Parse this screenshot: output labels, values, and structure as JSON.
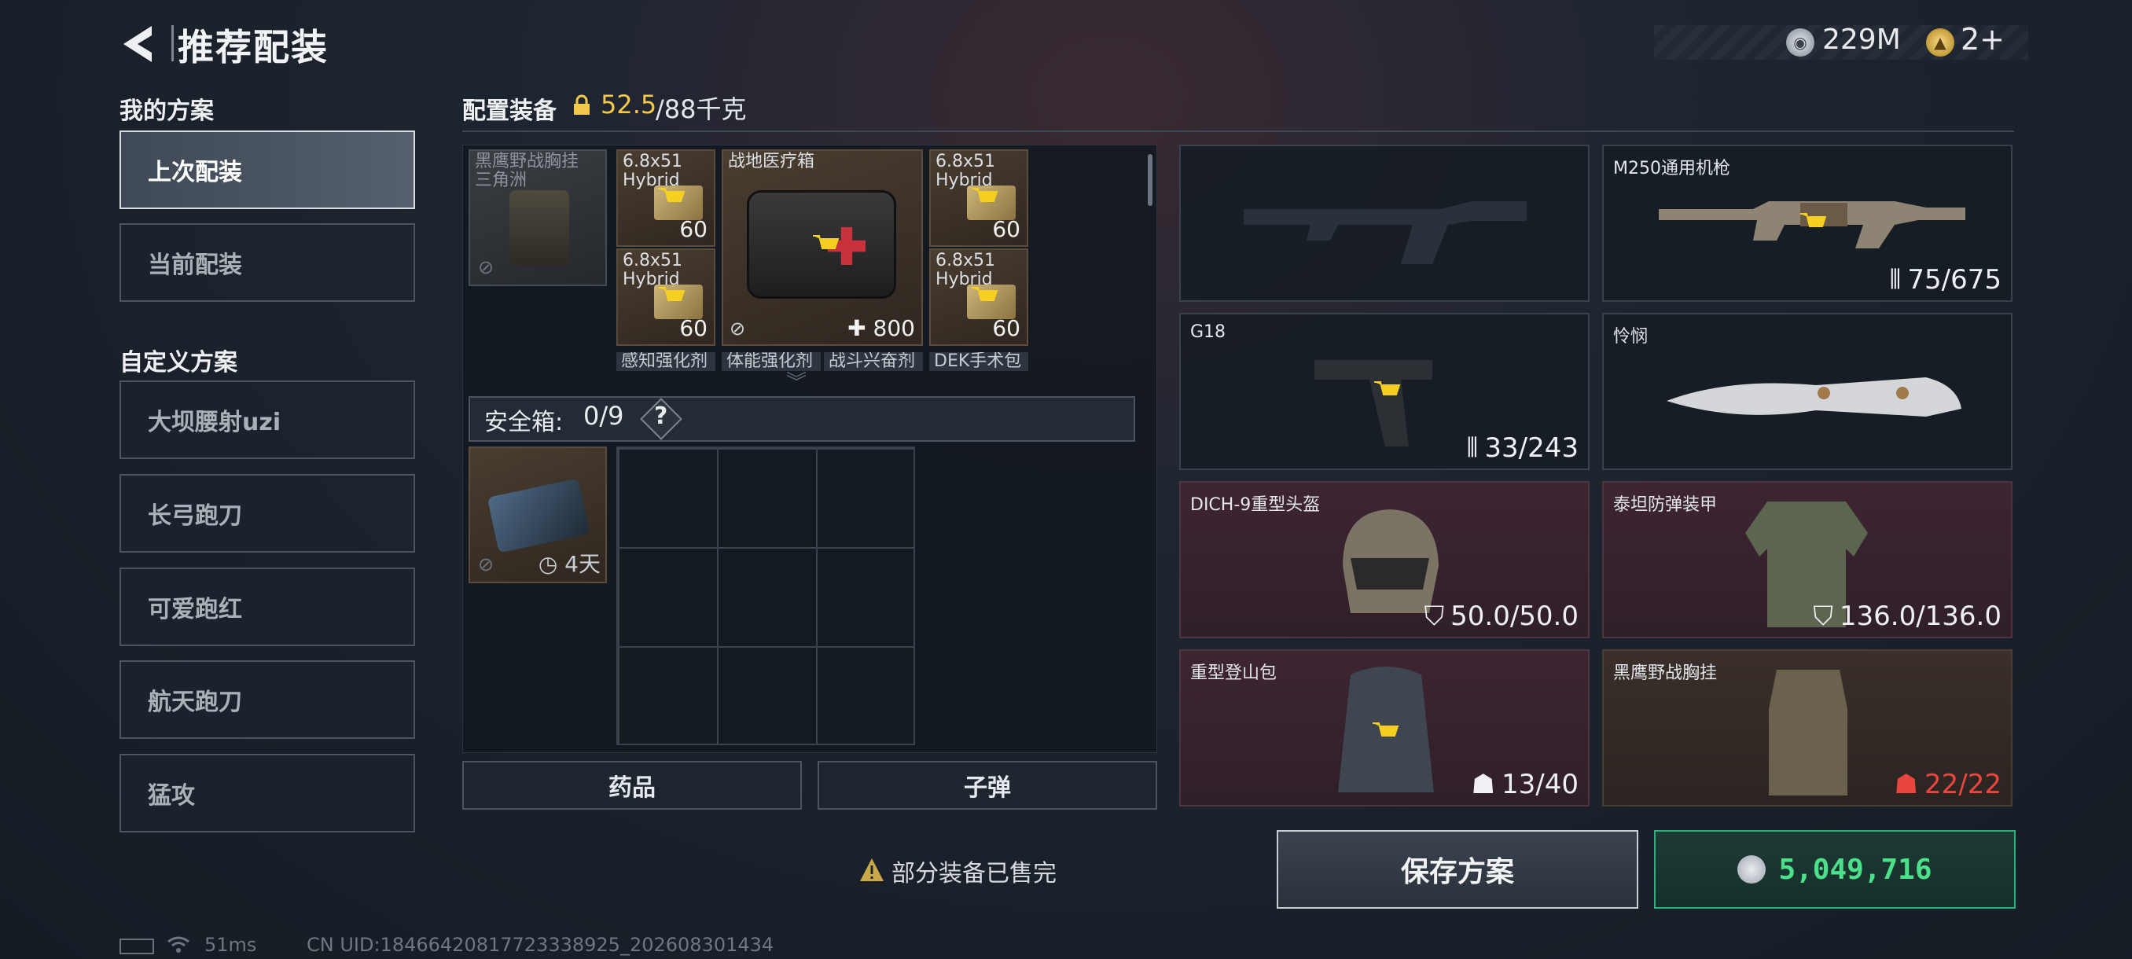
{
  "header": {
    "title": "推荐配装",
    "currency": [
      {
        "icon": "silver-coin-icon",
        "value": "229M"
      },
      {
        "icon": "gold-coin-icon",
        "value": "2+"
      }
    ]
  },
  "sidebar": {
    "my_plans_title": "我的方案",
    "my_plans": [
      {
        "label": "上次配装",
        "active": true
      },
      {
        "label": "当前配装",
        "active": false
      }
    ],
    "custom_plans_title": "自定义方案",
    "custom_plans": [
      {
        "label": "大坝腰射uzi"
      },
      {
        "label": "长弓跑刀"
      },
      {
        "label": "可爱跑红"
      },
      {
        "label": "航天跑刀"
      },
      {
        "label": "猛攻"
      }
    ]
  },
  "loadout": {
    "title": "配置装备",
    "weight_current": "52.5",
    "weight_max": "/88千克",
    "backpack_items": [
      {
        "label": "黑鹰野战胸挂三角洲"
      },
      {
        "label": "6.8x51 Hybrid",
        "qty": "60"
      },
      {
        "label": "6.8x51 Hybrid",
        "qty": "60"
      },
      {
        "label": "战地医疗箱",
        "qty": "800"
      },
      {
        "label": "6.8x51 Hybrid",
        "qty": "60"
      },
      {
        "label": "6.8x51 Hybrid",
        "qty": "60"
      }
    ],
    "strip_labels": [
      "感知强化剂",
      "体能强化剂",
      "战斗兴奋剂",
      "DEK手术包"
    ],
    "safe_box": {
      "label": "安全箱:",
      "count": "0/9",
      "help": "?"
    },
    "case_timer": "4天",
    "tabs": [
      "药品",
      "子弹"
    ]
  },
  "slots": [
    {
      "name": "",
      "value": "",
      "style": "empty"
    },
    {
      "name": "M250通用机枪",
      "value": "75/675",
      "value_icon": "ammo-icon",
      "style": "normal"
    },
    {
      "name": "G18",
      "value": "33/243",
      "value_icon": "ammo-icon",
      "style": "normal"
    },
    {
      "name": "怜悯",
      "value": "",
      "style": "normal"
    },
    {
      "name": "DICH-9重型头盔",
      "value": "50.0/50.0",
      "value_icon": "shield-icon",
      "style": "red"
    },
    {
      "name": "泰坦防弹装甲",
      "value": "136.0/136.0",
      "value_icon": "shield-icon",
      "style": "red"
    },
    {
      "name": "重型登山包",
      "value": "13/40",
      "value_icon": "backpack-icon",
      "style": "red"
    },
    {
      "name": "黑鹰野战胸挂",
      "value": "22/22",
      "value_icon": "backpack-icon",
      "style": "brown",
      "danger": true
    }
  ],
  "actions": {
    "warning": "部分装备已售完",
    "save_plan": "保存方案",
    "price": "5,049,716"
  },
  "status": {
    "ping": "51ms",
    "uid": "CN UID:18466420817723338925_202608301434"
  },
  "colors": {
    "accent_yellow": "#f2c94c",
    "price_green": "#4de08a",
    "danger_red": "#e8463f",
    "buy_border": "#27b37a"
  }
}
